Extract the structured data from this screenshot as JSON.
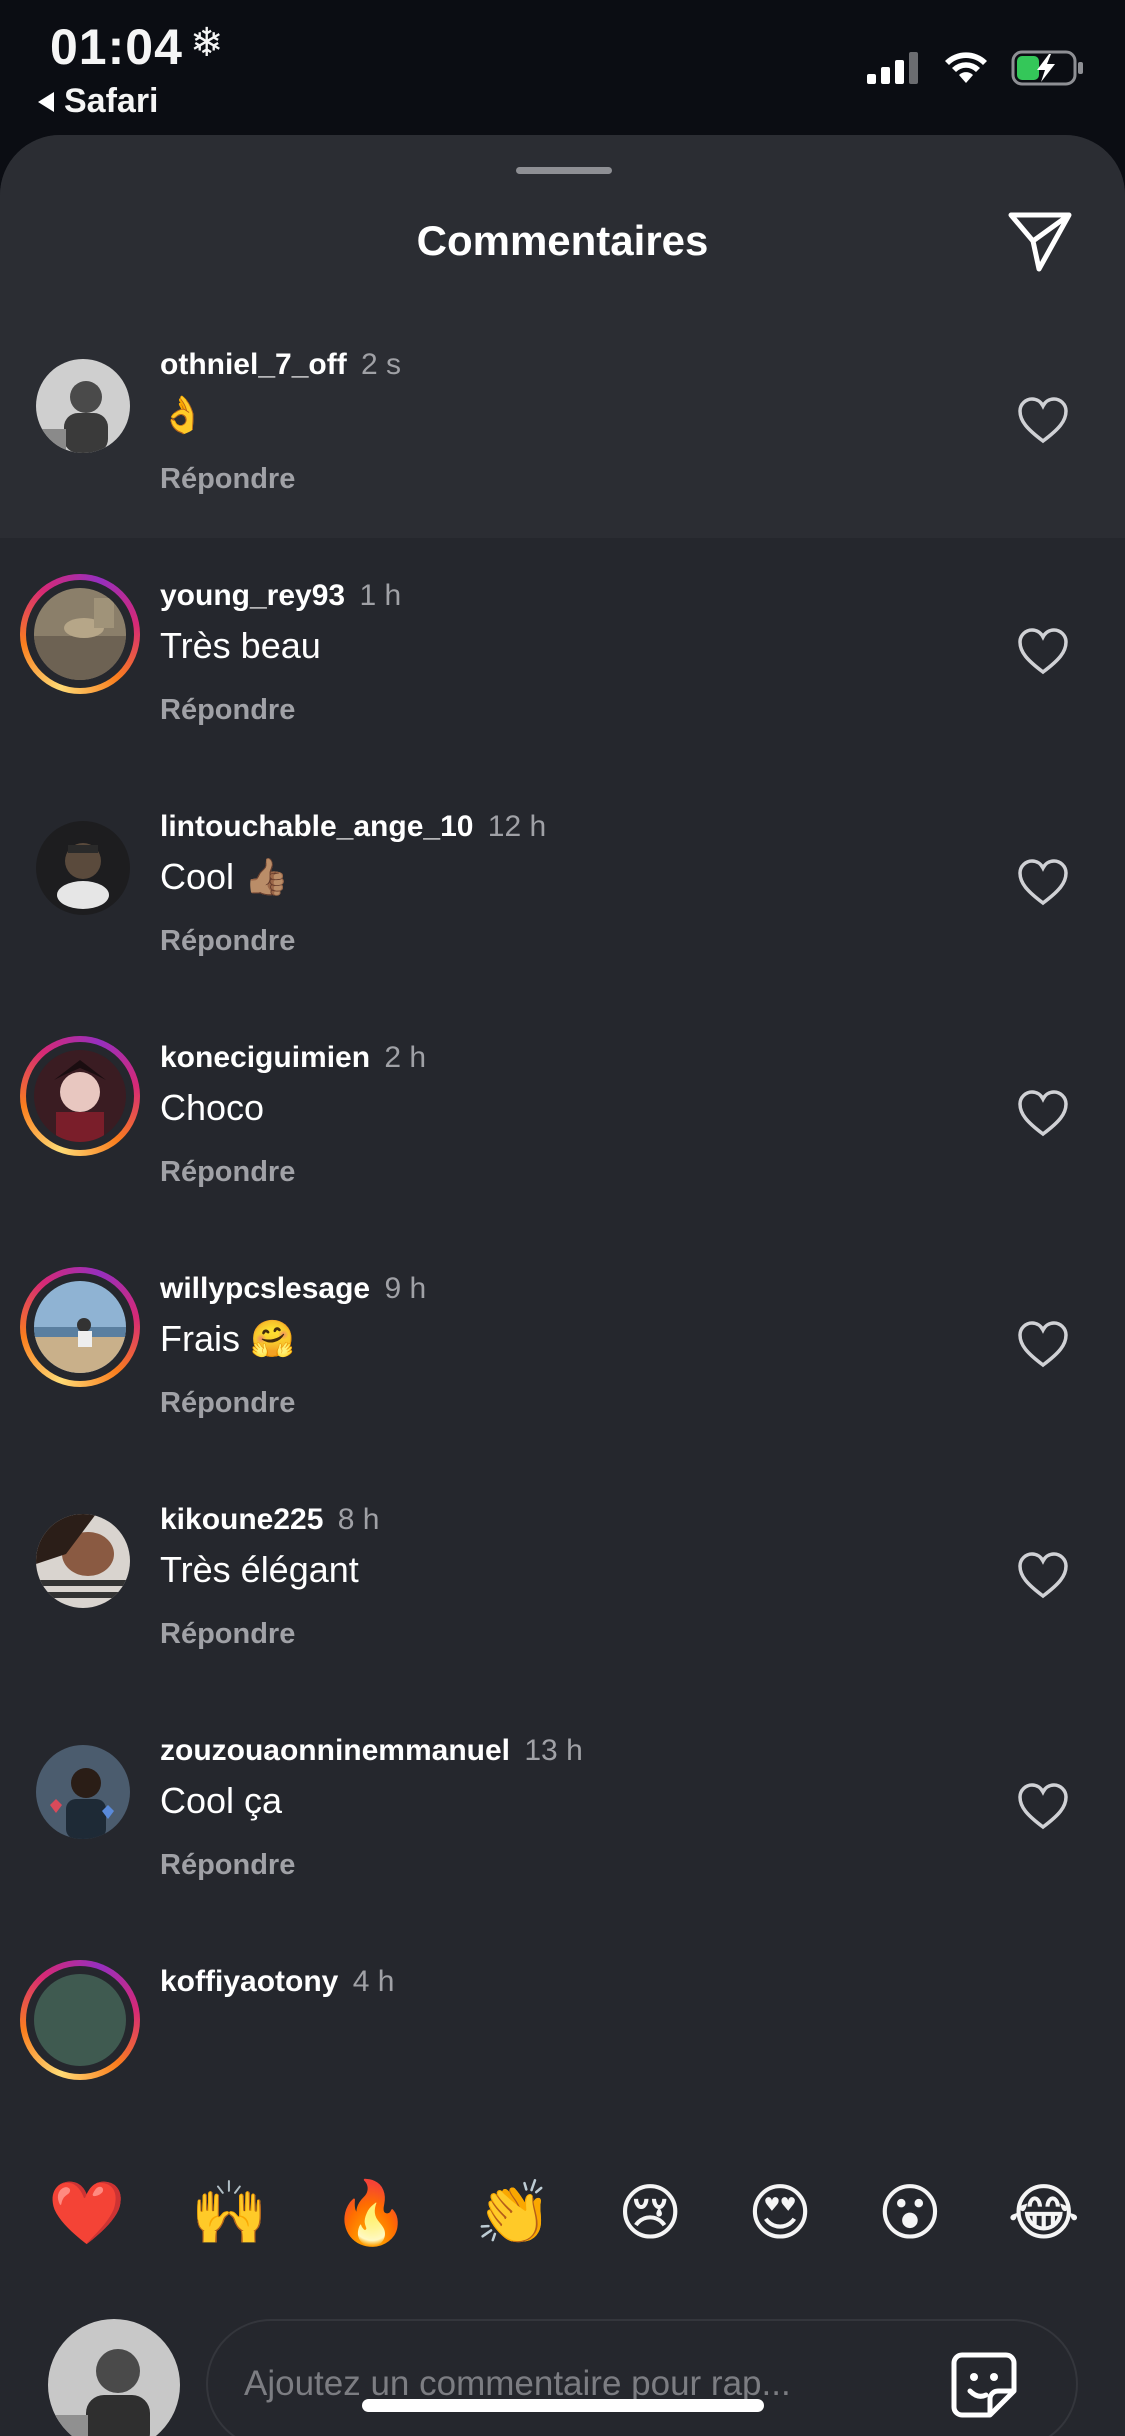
{
  "status_bar": {
    "time": "01:04",
    "time_icon": "snowflake-icon",
    "back_app": "Safari",
    "icons": [
      "cellular-signal-icon",
      "wifi-icon",
      "battery-charging-icon"
    ],
    "battery_color": "#34c759"
  },
  "sheet": {
    "title": "Commentaires",
    "action_icon": "send-icon"
  },
  "comments": [
    {
      "username": "othniel_7_off",
      "time": "2 s",
      "text": "👌",
      "reply_label": "Répondre",
      "story_ring": false,
      "highlight": true,
      "avatar_icon": "avatar-photo"
    },
    {
      "username": "young_rey93",
      "time": "1 h",
      "text": "Très beau",
      "reply_label": "Répondre",
      "story_ring": true,
      "highlight": false,
      "avatar_icon": "avatar-photo"
    },
    {
      "username": "lintouchable_ange_10",
      "time": "12 h",
      "text": "Cool 👍🏽",
      "reply_label": "Répondre",
      "story_ring": false,
      "highlight": false,
      "avatar_icon": "avatar-photo"
    },
    {
      "username": "koneciguimien",
      "time": "2 h",
      "text": "Choco",
      "reply_label": "Répondre",
      "story_ring": true,
      "highlight": false,
      "avatar_icon": "avatar-photo"
    },
    {
      "username": "willypcslesage",
      "time": "9 h",
      "text": "Frais 🤗",
      "reply_label": "Répondre",
      "story_ring": true,
      "highlight": false,
      "avatar_icon": "avatar-photo"
    },
    {
      "username": "kikoune225",
      "time": "8 h",
      "text": "Très élégant",
      "reply_label": "Répondre",
      "story_ring": false,
      "highlight": false,
      "avatar_icon": "avatar-photo"
    },
    {
      "username": "zouzouaonninemmanuel",
      "time": "13 h",
      "text": "Cool ça",
      "reply_label": "Répondre",
      "story_ring": false,
      "highlight": false,
      "avatar_icon": "avatar-photo"
    },
    {
      "username": "koffiyaotony",
      "time": "4 h",
      "text": "",
      "reply_label": "",
      "story_ring": true,
      "highlight": false,
      "avatar_icon": "avatar-photo"
    }
  ],
  "emoji_bar": [
    "❤️",
    "🙌",
    "🔥",
    "👏",
    "😢",
    "😍",
    "😮",
    "😂"
  ],
  "composer": {
    "placeholder": "Ajoutez un commentaire pour rap...",
    "value": "",
    "sticker_icon": "sticker-icon"
  },
  "colors": {
    "background": "#0b0d13",
    "sheet": "#25272d",
    "header": "#2b2d33",
    "muted_text": "#a0a1a6",
    "story_ring": [
      "#feda75",
      "#fa7e1e",
      "#d62976",
      "#962fbf"
    ]
  }
}
